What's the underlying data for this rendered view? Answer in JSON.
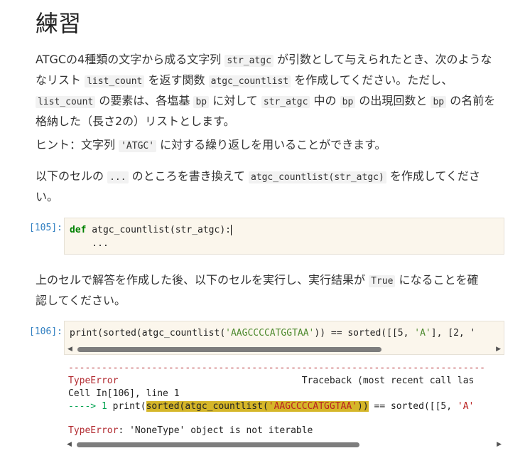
{
  "heading": "練習",
  "p1": {
    "t1": "ATGCの4種類の文字から成る文字列 ",
    "c1": "str_atgc",
    "t2": " が引数として与えられたとき、次のような",
    "t3": "なリスト ",
    "c2": "list_count",
    "t4": " を返す関数 ",
    "c3": "atgc_countlist",
    "t5": " を作成してください。ただし、",
    "c4": "list_count",
    "t6": " の要素は、各塩基 ",
    "c5": "bp",
    "t7": " に対して ",
    "c6": "str_atgc",
    "t8": " 中の ",
    "c7": "bp",
    "t9": " の出現回数と ",
    "c8": "bp",
    "t10": " の名前を",
    "t11": "格納した（長さ2の）リストとします。"
  },
  "p2": {
    "t1": "ヒント：文字列 ",
    "c1": "'ATGC'",
    "t2": " に対する繰り返しを用いることができます。"
  },
  "p3": {
    "t1": "以下のセルの ",
    "c1": "...",
    "t2": " のところを書き換えて ",
    "c2": "atgc_countlist(str_atgc)",
    "t3": " を作成してくださ",
    "t4": "い。"
  },
  "cell105": {
    "prompt": "[105]:",
    "kw": "def",
    "line1": " atgc_countlist(str_atgc):",
    "line2": "    ..."
  },
  "p4": {
    "t1": "上のセルで解答を作成した後、以下のセルを実行し、実行結果が ",
    "c1": "True",
    "t2": " になることを確",
    "t3": "認してください。"
  },
  "cell106": {
    "prompt": "[106]:",
    "a": "print(sorted(atgc_countlist(",
    "s": "'AAGCCCCATGGTAA'",
    "b": ")) == sorted([[5, ",
    "s2": "'A'",
    "c": "], [2, '"
  },
  "output": {
    "dashes": "---------------------------------------------------------------------------",
    "err1": "TypeError",
    "tb": "                                 Traceback (most recent call las",
    "cell_line": "Cell In[106], line 1",
    "arrow": "----> 1 ",
    "pre": "print(",
    "hl1": "sorted(atgc_countlist(",
    "hlstr": "'AAGCCCCATGGTAA'",
    "hl2": "))",
    "post": " == sorted([[5, ",
    "poststr": "'A'",
    "err2": "TypeError",
    "msg": ": 'NoneType' object is not iterable"
  },
  "colors": {
    "prompt": "#307fc1",
    "cell_bg": "#fbf6ec",
    "error": "#b22b31",
    "highlight": "#d5b629"
  }
}
